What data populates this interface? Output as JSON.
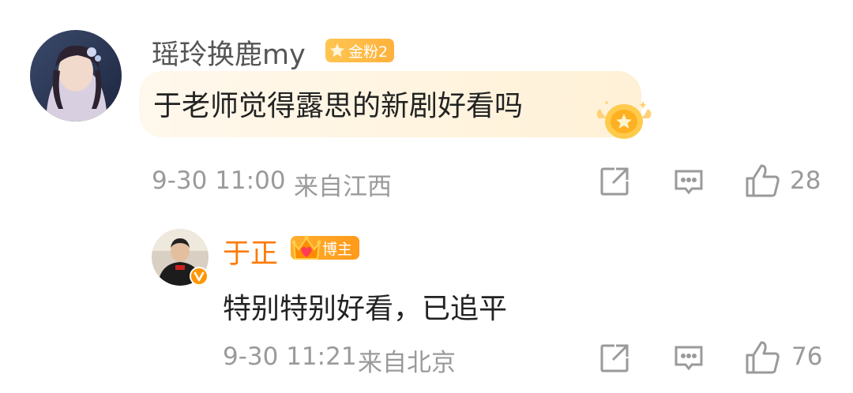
{
  "comment": {
    "author": "瑶玲换鹿my",
    "fan_badge": "金粉2",
    "text": "于老师觉得露思的新剧好看吗",
    "time": "9-30 11:00",
    "location": "来自江西",
    "likes": "28"
  },
  "reply": {
    "author": "于正",
    "author_badge": "博主",
    "text": "特别特别好看，已追平",
    "time": "9-30 11:21",
    "location": "来自北京",
    "likes": "76"
  },
  "colors": {
    "author_accent": "#ff7a00",
    "badge_gold": "#ffb23c",
    "meta_gray": "#9a9a9a"
  }
}
